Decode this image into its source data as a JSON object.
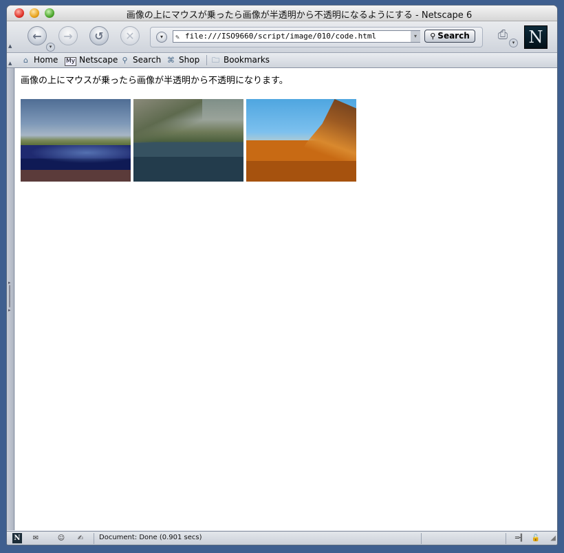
{
  "window": {
    "title": "画像の上にマウスが乗ったら画像が半透明から不透明になるようにする - Netscape 6"
  },
  "toolbar": {
    "url": "file:///ISO9660/script/image/010/code.html",
    "search_label": "Search"
  },
  "personal_toolbar": {
    "items": [
      {
        "label": "Home",
        "icon": "home-icon"
      },
      {
        "label": "Netscape",
        "icon": "my-netscape-icon",
        "icon_text": "My"
      },
      {
        "label": "Search",
        "icon": "search-icon"
      },
      {
        "label": "Shop",
        "icon": "shop-icon"
      },
      {
        "label": "Bookmarks",
        "icon": "bookmarks-folder-icon"
      }
    ]
  },
  "page": {
    "text": "画像の上にマウスが乗ったら画像が半透明から不透明になります。",
    "images": [
      {
        "scene": "coastal-landscape"
      },
      {
        "scene": "mountain-lake"
      },
      {
        "scene": "desert-mountain"
      }
    ]
  },
  "statusbar": {
    "text": "Document: Done (0.901 secs)"
  },
  "logo": {
    "letter": "N",
    "small_letter": "N"
  }
}
